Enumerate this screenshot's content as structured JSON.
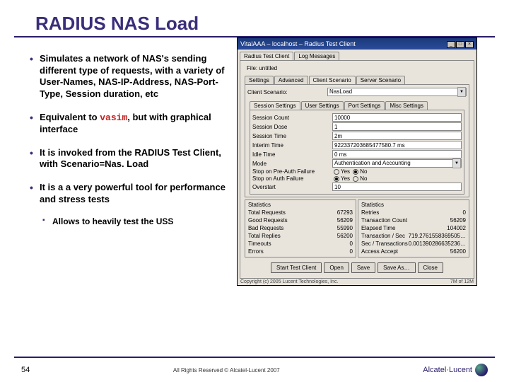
{
  "title": "RADIUS NAS Load",
  "bullets": [
    {
      "text": "Simulates a network of NAS's sending different type of requests, with a variety of User-Names, NAS-IP-Address, NAS-Port-Type, Session duration, etc"
    },
    {
      "text_pre": "Equivalent to ",
      "code": "vasim",
      "text_post": ", but with graphical interface"
    },
    {
      "text": "It is invoked from the RADIUS Test Client, with Scenario=Nas. Load"
    },
    {
      "text": "It is a a very powerful tool for performance and stress tests"
    },
    {
      "text": "Allows to heavily test the USS",
      "sub": true
    }
  ],
  "window": {
    "title": "VitalAAA – localhost – Radius Test Client",
    "file_label": "File: untitled",
    "main_tabs": [
      {
        "label": "Radius Test Client",
        "active": true
      },
      {
        "label": "Log Messages"
      }
    ],
    "scenario_tabs": [
      {
        "label": "Settings"
      },
      {
        "label": "Advanced"
      },
      {
        "label": "Client Scenario",
        "active": true
      },
      {
        "label": "Server Scenario"
      }
    ],
    "scenario_row": {
      "label": "Client Scenario:",
      "value": "NasLoad"
    },
    "setting_tabs": [
      {
        "label": "Session Settings",
        "active": true
      },
      {
        "label": "User Settings"
      },
      {
        "label": "Port Settings"
      },
      {
        "label": "Misc Settings"
      }
    ],
    "settings": [
      {
        "label": "Session Count",
        "value": "10000",
        "type": "input"
      },
      {
        "label": "Session Dose",
        "value": "1",
        "type": "input"
      },
      {
        "label": "Session Time",
        "value": "2m",
        "type": "input"
      },
      {
        "label": "Interim Time",
        "value": "922337203685477580.7 ms",
        "type": "input"
      },
      {
        "label": "Idle Time",
        "value": "0 ms",
        "type": "input"
      },
      {
        "label": "Mode",
        "value": "Authentication and Accounting",
        "type": "select"
      },
      {
        "label": "Stop on Pre-Auth Failure",
        "type": "radio",
        "yes": false,
        "no": true
      },
      {
        "label": "Stop on Auth Failure",
        "type": "radio",
        "yes": true,
        "no": false
      },
      {
        "label": "Overstart",
        "value": "10",
        "type": "input"
      }
    ],
    "stats_left": {
      "title": "Statistics",
      "rows": [
        {
          "k": "Total Requests",
          "v": "67293"
        },
        {
          "k": "Good Requests",
          "v": "56209"
        },
        {
          "k": "Bad Requests",
          "v": "55990"
        },
        {
          "k": "Total Replies",
          "v": "56200"
        },
        {
          "k": "Timeouts",
          "v": "0"
        },
        {
          "k": "Errors",
          "v": "0"
        }
      ]
    },
    "stats_right": {
      "title": "Statistics",
      "rows": [
        {
          "k": "Retries",
          "v": "0"
        },
        {
          "k": "Transaction Count",
          "v": "56209"
        },
        {
          "k": "Elapsed Time",
          "v": "104002"
        },
        {
          "k": "Transaction / Sec",
          "v": "719.2761558369505…"
        },
        {
          "k": "Sec / Transactions",
          "v": "0.001390286635236…"
        },
        {
          "k": "Access Accept",
          "v": "56200"
        }
      ]
    },
    "buttons": [
      "Start Test Client",
      "Open",
      "Save",
      "Save As…",
      "Close"
    ],
    "copyright": "Copyright (c) 2005 Lucent Technologies, Inc.",
    "mem": "7M of 12M"
  },
  "footer": {
    "page": "54",
    "text": "All Rights Reserved © Alcatel-Lucent 2007",
    "brand": "Alcatel·Lucent"
  }
}
